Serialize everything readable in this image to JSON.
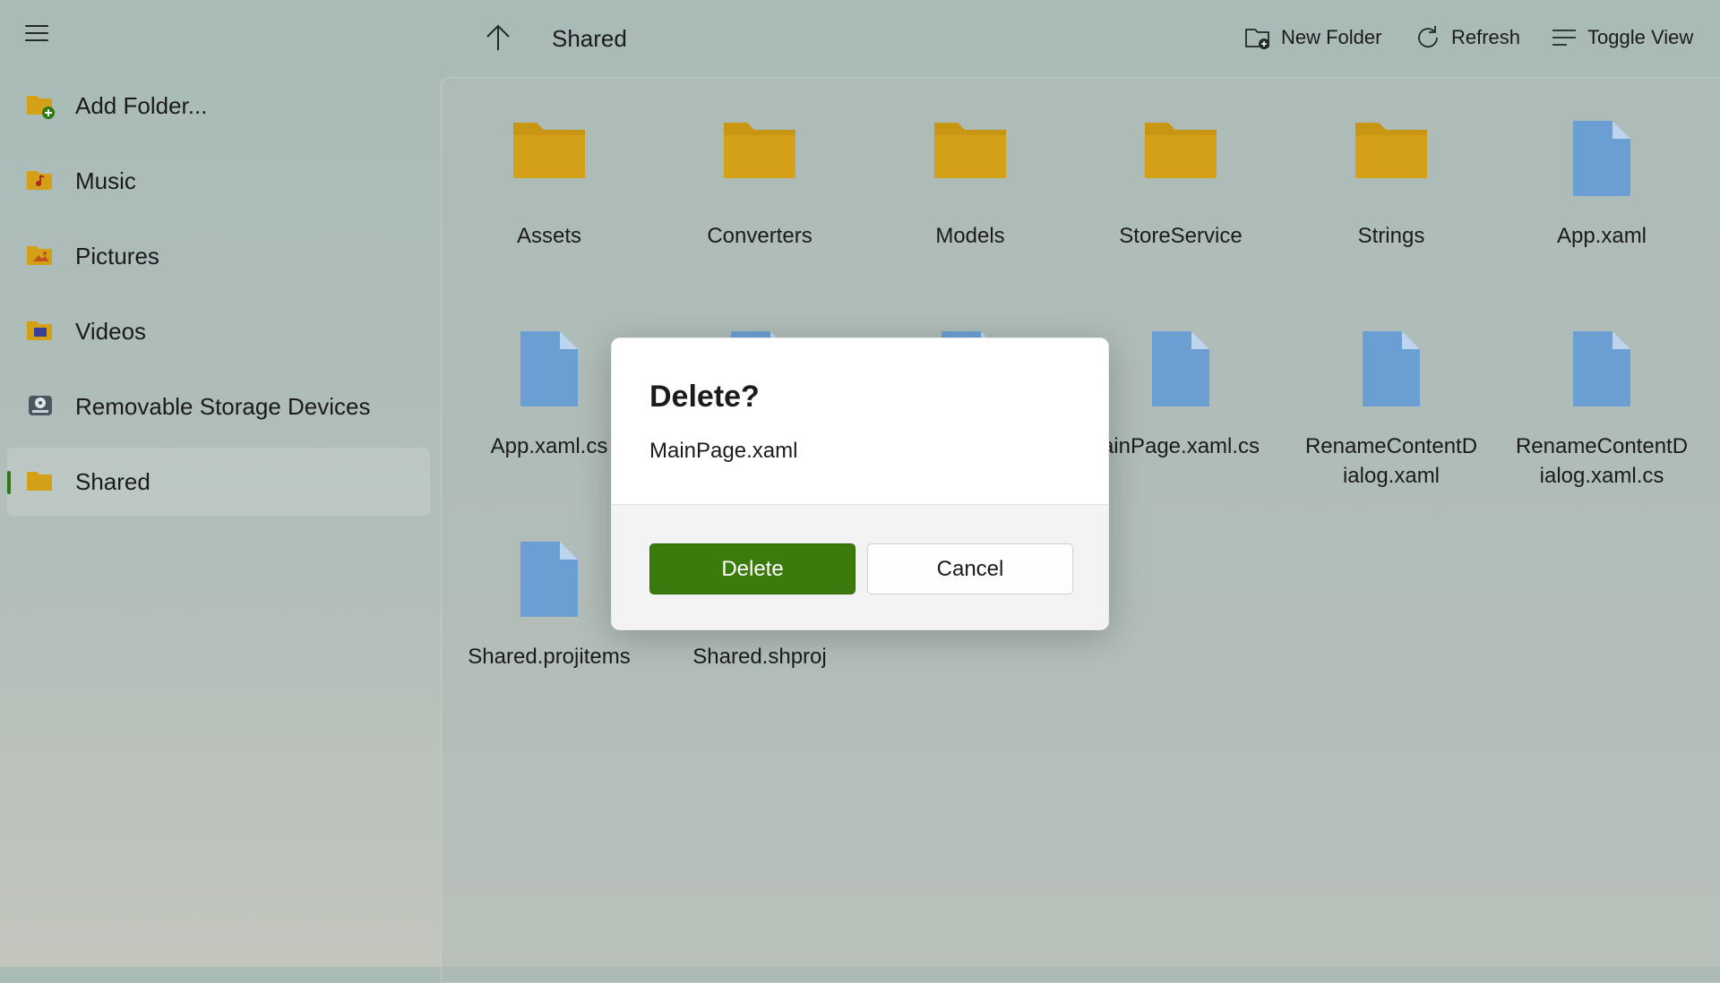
{
  "sidebar": {
    "items": [
      {
        "label": "Add Folder...",
        "icon": "folder-add-icon"
      },
      {
        "label": "Music",
        "icon": "music-folder-icon"
      },
      {
        "label": "Pictures",
        "icon": "pictures-folder-icon"
      },
      {
        "label": "Videos",
        "icon": "videos-folder-icon"
      },
      {
        "label": "Removable Storage Devices",
        "icon": "drive-icon"
      },
      {
        "label": "Shared",
        "icon": "folder-icon",
        "selected": true
      }
    ]
  },
  "toolbar": {
    "current_folder": "Shared",
    "new_folder_label": "New Folder",
    "refresh_label": "Refresh",
    "toggle_view_label": "Toggle View"
  },
  "files": [
    {
      "name": "Assets",
      "type": "folder"
    },
    {
      "name": "Converters",
      "type": "folder"
    },
    {
      "name": "Models",
      "type": "folder"
    },
    {
      "name": "StoreService",
      "type": "folder"
    },
    {
      "name": "Strings",
      "type": "folder"
    },
    {
      "name": "App.xaml",
      "type": "file"
    },
    {
      "name": "App.xaml.cs",
      "type": "file"
    },
    {
      "name": "",
      "type": "file"
    },
    {
      "name": "",
      "type": "file"
    },
    {
      "name": "ainPage.xaml.cs",
      "type": "file"
    },
    {
      "name": "RenameContentDialog.xaml",
      "type": "file",
      "line1": "RenameContentD",
      "line2": "ialog.xaml"
    },
    {
      "name": "RenameContentDialog.xaml.cs",
      "type": "file",
      "line1": "RenameContentD",
      "line2": "ialog.xaml.cs"
    },
    {
      "name": "Shared.projitems",
      "type": "file"
    },
    {
      "name": "Shared.shproj",
      "type": "file"
    }
  ],
  "dialog": {
    "title": "Delete?",
    "message": "MainPage.xaml",
    "primary_label": "Delete",
    "secondary_label": "Cancel"
  },
  "colors": {
    "accent": "#3b7a0c",
    "folder": "#d4a017",
    "file": "#6b9fd4"
  }
}
